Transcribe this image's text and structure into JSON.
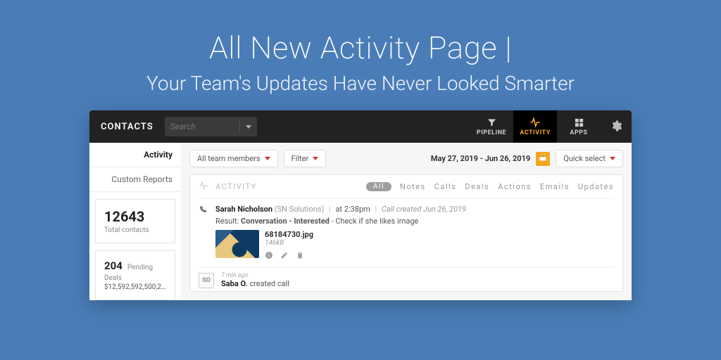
{
  "hero": {
    "title": "All New Activity Page |",
    "subtitle": "Your Team's Updates Have Never Looked Smarter"
  },
  "brand": "CONTACTS",
  "search": {
    "placeholder": "Search"
  },
  "nav": {
    "pipeline": "PIPELINE",
    "activity": "ACTIVITY",
    "apps": "APPS"
  },
  "sidebar": {
    "activity": "Activity",
    "custom_reports": "Custom Reports",
    "stat1": {
      "value": "12643",
      "label": "Total contacts"
    },
    "stat2": {
      "value": "204",
      "label": "Pending Deals",
      "amount": "$12,592,592,500,2..."
    }
  },
  "toolbar": {
    "members": "All team members",
    "filter": "Filter",
    "range": "May 27, 2019 - Jun 26, 2019",
    "quick": "Quick select"
  },
  "panel": {
    "title": "ACTIVITY",
    "chips": {
      "all": "All",
      "notes": "Notes",
      "calls": "Calls",
      "deals": "Deals",
      "actions": "Actions",
      "emails": "Emails",
      "updates": "Updates"
    }
  },
  "entry1": {
    "name": "Sarah Nicholson",
    "org": "(SN Solutions)",
    "time": "at 2:38pm",
    "meta": "Call created Jun 26, 2019",
    "result_label": "Result:",
    "result_value": "Conversation - Interested",
    "result_note": "- Check if she likes image",
    "file": {
      "name": "68184730.jpg",
      "size": "146kB"
    }
  },
  "entry2": {
    "initials": "SO",
    "time": "7 min ago",
    "name": "Saba O.",
    "action": "created call"
  }
}
